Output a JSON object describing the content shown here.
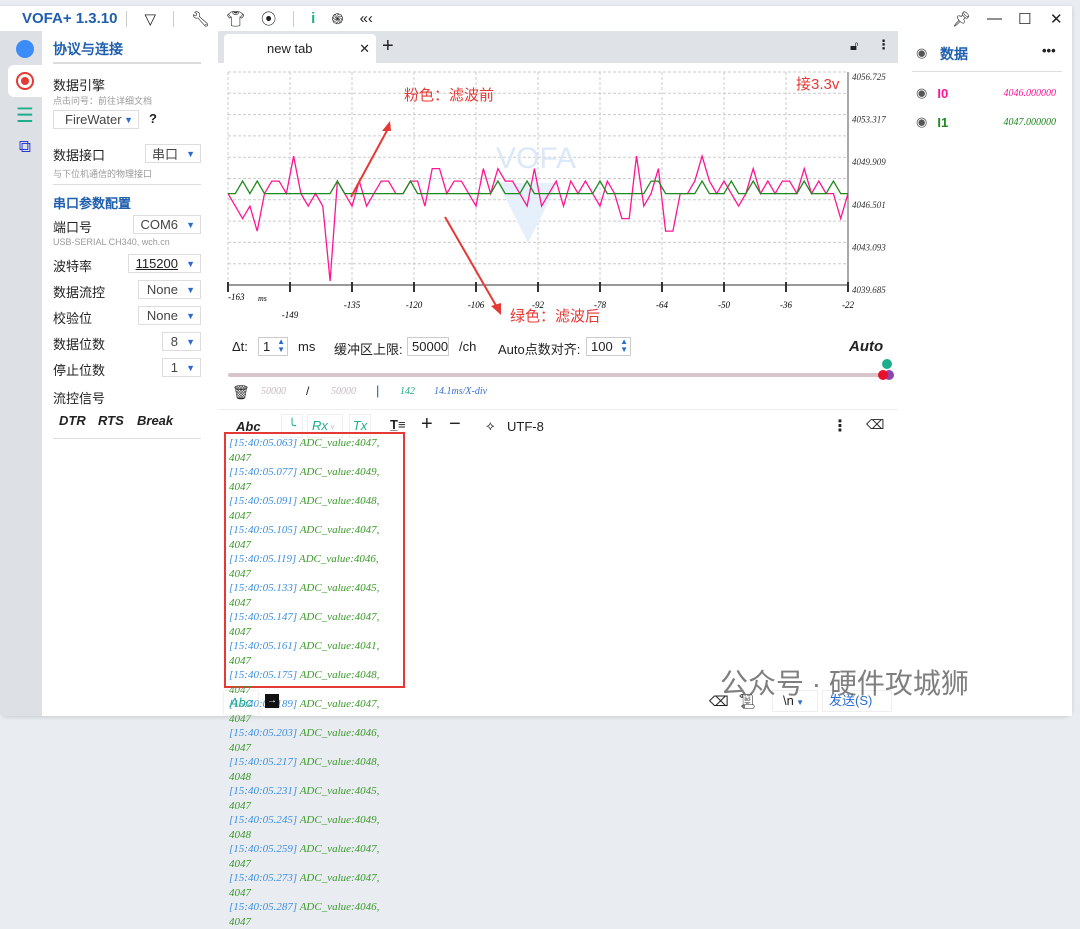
{
  "app": {
    "title": "VOFA+ 1.3.10"
  },
  "toolbar": {
    "icons": [
      "vofa-logo-icon",
      "wrench-icon",
      "shirt-icon",
      "capture-icon",
      "info-icon",
      "fingerprint-icon",
      "collapse-icon"
    ]
  },
  "sidebar": {
    "section_title": "协议与连接",
    "engine_label": "数据引擎",
    "engine_hint": "点击问号：前往详细文档",
    "engine_value": "FireWater",
    "help": "?",
    "interface_label": "数据接口",
    "interface_value": "串口",
    "interface_hint": "与下位机通信的物理接口",
    "serial_title": "串口参数配置",
    "port_label": "端口号",
    "port_value": "COM6",
    "port_desc": "USB-SERIAL CH340, wch.cn",
    "baud_label": "波特率",
    "baud_value": "115200",
    "flow_label": "数据流控",
    "flow_value": "None",
    "parity_label": "校验位",
    "parity_value": "None",
    "databits_label": "数据位数",
    "databits_value": "8",
    "stopbits_label": "停止位数",
    "stopbits_value": "1",
    "signal_label": "流控信号",
    "dtr": "DTR",
    "rts": "RTS",
    "break": "Break"
  },
  "tabs": [
    {
      "label": "new tab"
    }
  ],
  "annotations": {
    "pink": "粉色：滤波前",
    "green": "绿色：滤波后",
    "note": "接3.3v"
  },
  "chart_data": {
    "type": "line",
    "watermark": "VOFA",
    "xunit": "ms",
    "xlim": [
      -163,
      -22
    ],
    "xticks": [
      -163,
      -149,
      -135,
      -120,
      -106,
      -92,
      -78,
      -64,
      -50,
      -36,
      -22
    ],
    "ylim": [
      4039.685,
      4056.725
    ],
    "yticks": [
      "4056.725",
      "4053.317",
      "4049.909",
      "4046.501",
      "4043.093",
      "4039.685"
    ],
    "grid": true,
    "series": [
      {
        "name": "I0",
        "color": "#ff1493",
        "values": [
          4047,
          4046,
          4045,
          4046,
          4044,
          4047,
          4048,
          4048,
          4047,
          4050,
          4047,
          4046,
          4047,
          4046,
          4040,
          4048,
          4047,
          4046,
          4048,
          4046,
          4047,
          4048,
          4048,
          4047,
          4047,
          4048,
          4048,
          4046,
          4049,
          4049,
          4047,
          4048,
          4048,
          4047,
          4046,
          4049,
          4047,
          4049,
          4048,
          4048,
          4047,
          4046,
          4049,
          4046,
          4047,
          4048,
          4046,
          4048,
          4047,
          4048,
          4047,
          4046,
          4048,
          4047,
          4045,
          4045,
          4050,
          4046,
          4047,
          4049,
          4044,
          4044,
          4047,
          4047,
          4048,
          4050,
          4048,
          4047,
          4048,
          4047,
          4046,
          4047,
          4049,
          4047,
          4048,
          4047,
          4048,
          4048,
          4047,
          4049,
          4047,
          4048,
          4047,
          4047,
          4045,
          4047
        ]
      },
      {
        "name": "I1",
        "color": "#1e8a1e",
        "values": [
          4047,
          4047,
          4048,
          4047,
          4048,
          4047,
          4047,
          4047,
          4047,
          4047,
          4047,
          4047,
          4047,
          4047,
          4047,
          4048,
          4047,
          4047,
          4047,
          4047,
          4047,
          4047,
          4047,
          4047,
          4047,
          4048,
          4047,
          4047,
          4047,
          4047,
          4047,
          4047,
          4047,
          4047,
          4047,
          4047,
          4047,
          4048,
          4047,
          4047,
          4047,
          4048,
          4047,
          4047,
          4047,
          4047,
          4047,
          4047,
          4047,
          4047,
          4047,
          4048,
          4047,
          4047,
          4047,
          4047,
          4047,
          4047,
          4048,
          4048,
          4047,
          4047,
          4047,
          4047,
          4047,
          4048,
          4047,
          4047,
          4047,
          4048,
          4047,
          4047,
          4048,
          4047,
          4047,
          4047,
          4047,
          4047,
          4047,
          4048,
          4047,
          4047,
          4047,
          4048,
          4047,
          4047
        ]
      }
    ]
  },
  "controls": {
    "dt_label": "Δt:",
    "dt_value": "1",
    "dt_unit": "ms",
    "buffer_label": "缓冲区上限:",
    "buffer_value": "50000",
    "buffer_unit": "/ch",
    "auto_label": "Auto点数对齐:",
    "auto_value": "100",
    "auto_button": "Auto",
    "slider_position": 1.0
  },
  "status": {
    "count": "50000",
    "sep": "/",
    "limit": "50000",
    "bar": "|",
    "points": "142",
    "xdiv": "14.1ms/X-div"
  },
  "receive_toolbar": {
    "abc": "Abc",
    "rx": "Rx",
    "tx": "Tx",
    "encoding": "UTF-8"
  },
  "log": [
    {
      "ts": "[15:40:05.063]",
      "msg": "ADC_value:4047, 4047"
    },
    {
      "ts": "[15:40:05.077]",
      "msg": "ADC_value:4049, 4047"
    },
    {
      "ts": "[15:40:05.091]",
      "msg": "ADC_value:4048, 4047"
    },
    {
      "ts": "[15:40:05.105]",
      "msg": "ADC_value:4047, 4047"
    },
    {
      "ts": "[15:40:05.119]",
      "msg": "ADC_value:4046, 4047"
    },
    {
      "ts": "[15:40:05.133]",
      "msg": "ADC_value:4045, 4047"
    },
    {
      "ts": "[15:40:05.147]",
      "msg": "ADC_value:4047, 4047"
    },
    {
      "ts": "[15:40:05.161]",
      "msg": "ADC_value:4041, 4047"
    },
    {
      "ts": "[15:40:05.175]",
      "msg": "ADC_value:4048, 4047"
    },
    {
      "ts": "[15:40:05.189]",
      "msg": "ADC_value:4047, 4047"
    },
    {
      "ts": "[15:40:05.203]",
      "msg": "ADC_value:4046, 4047"
    },
    {
      "ts": "[15:40:05.217]",
      "msg": "ADC_value:4048, 4048"
    },
    {
      "ts": "[15:40:05.231]",
      "msg": "ADC_value:4045, 4047"
    },
    {
      "ts": "[15:40:05.245]",
      "msg": "ADC_value:4049, 4048"
    },
    {
      "ts": "[15:40:05.259]",
      "msg": "ADC_value:4047, 4047"
    },
    {
      "ts": "[15:40:05.273]",
      "msg": "ADC_value:4047, 4047"
    },
    {
      "ts": "[15:40:05.287]",
      "msg": "ADC_value:4046, 4047"
    }
  ],
  "send": {
    "abc": "Abc",
    "newline": "\\n",
    "send_label": "发送(S)"
  },
  "right": {
    "title": "数据",
    "more": "•••",
    "channels": [
      {
        "name": "I0",
        "value": "4046.000000",
        "color": "#ff1493"
      },
      {
        "name": "I1",
        "value": "4047.000000",
        "color": "#1e8a1e"
      }
    ]
  },
  "watermark": "公众号 · 硬件攻城狮"
}
